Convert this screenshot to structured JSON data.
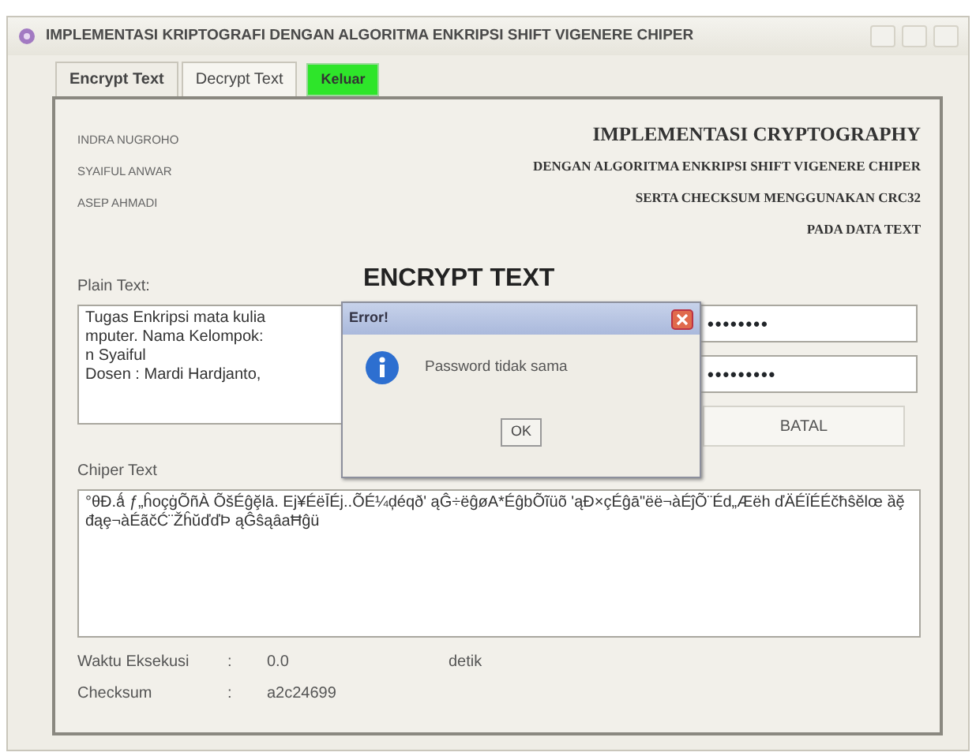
{
  "window": {
    "title": "IMPLEMENTASI KRIPTOGRAFI DENGAN ALGORITMA ENKRIPSI SHIFT VIGENERE CHIPER"
  },
  "tabs": [
    {
      "label": "Encrypt Text",
      "selected": true
    },
    {
      "label": "Decrypt Text",
      "selected": false
    }
  ],
  "exit_button": {
    "label": "Keluar"
  },
  "authors": [
    "INDRA NUGROHO",
    "SYAIFUL ANWAR",
    "ASEP AHMADI"
  ],
  "heading_lines": [
    "IMPLEMENTASI CRYPTOGRAPHY",
    "DENGAN ALGORITMA ENKRIPSI SHIFT VIGENERE CHIPER",
    "SERTA CHECKSUM MENGGUNAKAN CRC32",
    "PADA DATA TEXT"
  ],
  "section_title": "ENCRYPT TEXT",
  "plain_text": {
    "label": "Plain Text:",
    "lines": [
      "Tugas Enkripsi mata kulia",
      "mputer. Nama Kelompok:",
      "n Syaiful",
      "Dosen : Mardi Hardjanto,"
    ]
  },
  "password_fields": [
    "••••••••",
    "•••••••••"
  ],
  "cancel_button": {
    "label": "BATAL"
  },
  "chiper_text": {
    "label": "Chiper Text",
    "value": "°θÐ.ǻ   ƒ„ĥoçġÕñÀ  ÕšÉĝḝlā. Ej¥ÉëĪÉj..ÕÉ¼ḑéqð' ąĜ÷ëĝøA*ÉĝbÕĩüõ 'ąĐ×çÉĝā\"ëë¬àÉĵÕ¨Éd„Æëh ďÄÉÏÉÉčħŝĕlœ ȁḝđąȩ¬àÉãčĆ¨ŽĥŭďďÞ ąĜŝąȃaĦĝü"
  },
  "results": [
    {
      "label": "Waktu Eksekusi",
      "separator": ":",
      "value": "0.0",
      "unit": "detik"
    },
    {
      "label": "Checksum",
      "separator": ":",
      "value": "a2c24699"
    }
  ],
  "dialog": {
    "title": "Error!",
    "message": "Password tidak sama",
    "button": "OK"
  }
}
